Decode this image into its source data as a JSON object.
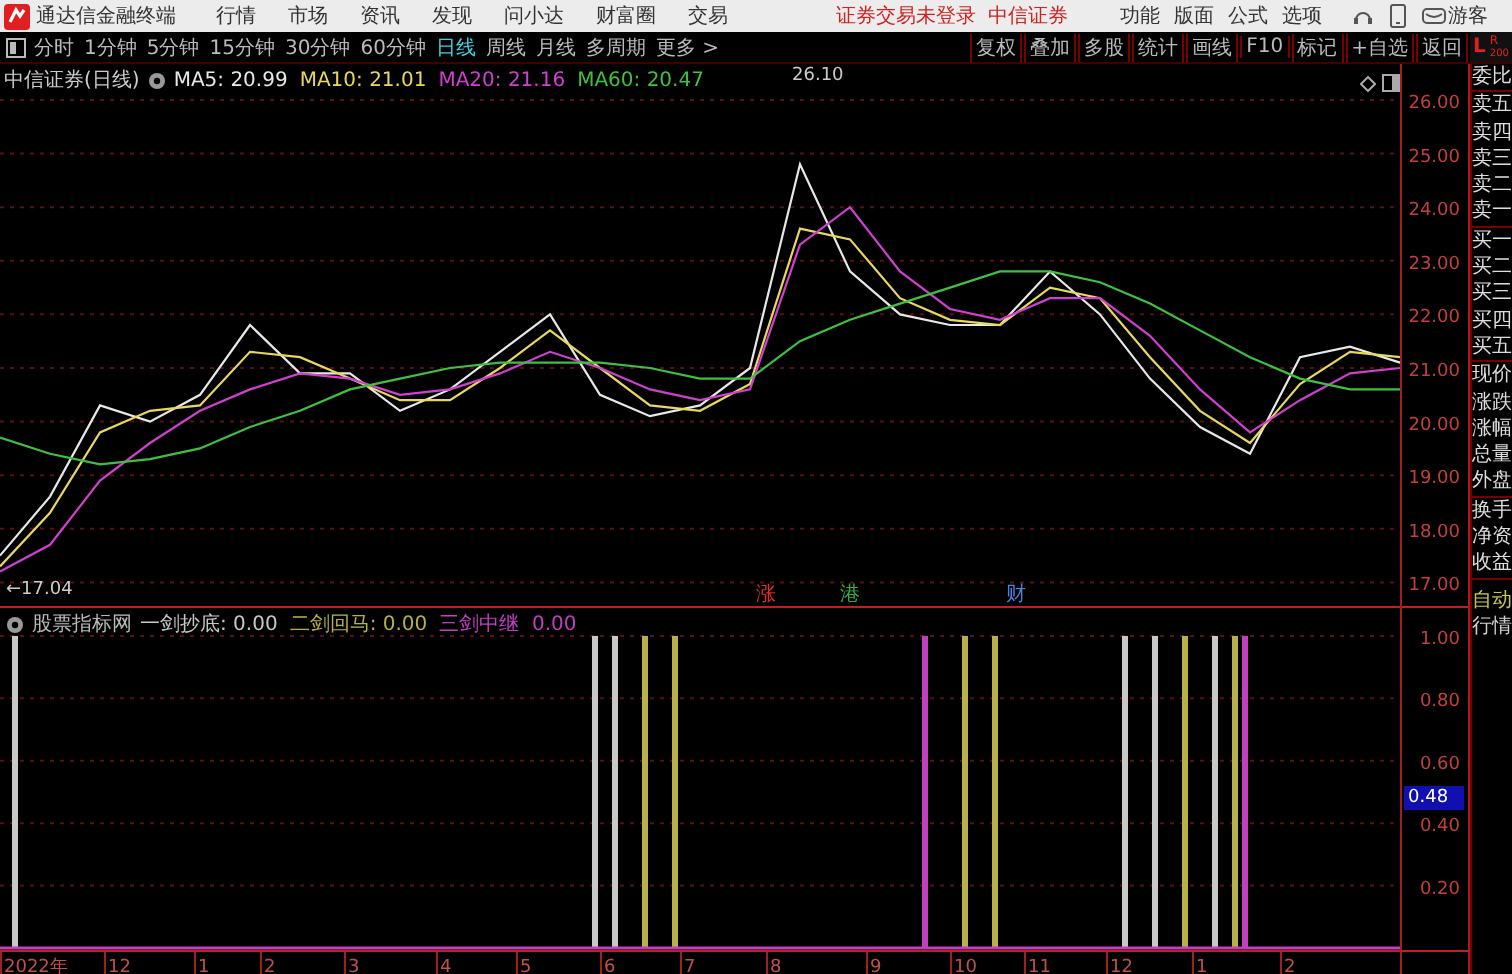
{
  "app_bar": {
    "app_name": "通达信金融终端",
    "menus": [
      "行情",
      "市场",
      "资讯",
      "发现",
      "问小达",
      "财富圈",
      "交易"
    ],
    "login_status": "证券交易未登录",
    "broker": "中信证券",
    "tools": [
      "功能",
      "版面",
      "公式",
      "选项"
    ],
    "user": "游客"
  },
  "period_bar": {
    "periods": [
      {
        "label": "分时",
        "selected": false
      },
      {
        "label": "1分钟",
        "selected": false
      },
      {
        "label": "5分钟",
        "selected": false
      },
      {
        "label": "15分钟",
        "selected": false
      },
      {
        "label": "30分钟",
        "selected": false
      },
      {
        "label": "60分钟",
        "selected": false
      },
      {
        "label": "日线",
        "selected": true
      },
      {
        "label": "周线",
        "selected": false
      },
      {
        "label": "月线",
        "selected": false
      },
      {
        "label": "多周期",
        "selected": false
      },
      {
        "label": "更多 >",
        "selected": false
      }
    ],
    "actions": [
      "复权",
      "叠加",
      "多股",
      "统计",
      "画线",
      "F10",
      "标记",
      "+自选",
      "返回"
    ]
  },
  "quote_badge": {
    "left": "L",
    "right": "R",
    "sub": "200"
  },
  "main_chart": {
    "title": "中信证券(日线)",
    "legend": [
      ": 20.99",
      ": 21.01",
      ": 21.16",
      ": 20.47"
    ],
    "event_tags": [
      {
        "label": "涨",
        "color": "#d83030"
      },
      {
        "label": "港",
        "color": "#30b040"
      },
      {
        "label": "财",
        "color": "#5080e0"
      }
    ],
    "chart_data": {
      "type": "line",
      "grid": true,
      "categories": [
        null,
        null,
        null,
        null,
        null,
        null,
        null,
        null,
        null,
        null,
        null,
        null,
        null,
        null,
        null,
        null,
        null,
        null,
        null,
        null,
        null,
        null,
        null,
        null,
        null,
        null,
        null,
        null,
        null
      ],
      "ylim": [
        16.56,
        26.67
      ],
      "yticks": [
        {
          "value": 17,
          "label": "17.00"
        },
        {
          "value": 18,
          "label": "18.00"
        },
        {
          "value": 19,
          "label": "19.00"
        },
        {
          "value": 20,
          "label": "20.00"
        },
        {
          "value": 21,
          "label": "21.00"
        },
        {
          "value": 22,
          "label": "22.00"
        },
        {
          "value": 23,
          "label": "23.00"
        },
        {
          "value": 24,
          "label": "24.00"
        },
        {
          "value": 25,
          "label": "25.00"
        },
        {
          "value": 26,
          "label": "26.00"
        }
      ],
      "series": [
        {
          "name": "MA5",
          "color": "#e8e8e8",
          "values": [
            17.5,
            18.6,
            20.3,
            20.0,
            20.5,
            21.8,
            20.9,
            20.9,
            20.2,
            20.6,
            21.3,
            22.0,
            20.5,
            20.1,
            20.3,
            21.0,
            24.8,
            22.8,
            22.0,
            21.8,
            21.8,
            22.8,
            22.0,
            20.8,
            19.9,
            19.4,
            21.2,
            21.4,
            21.1
          ]
        },
        {
          "name": "MA10",
          "color": "#e8d860",
          "values": [
            17.3,
            18.3,
            19.8,
            20.2,
            20.3,
            21.3,
            21.2,
            20.8,
            20.4,
            20.4,
            21.0,
            21.7,
            21.0,
            20.3,
            20.2,
            20.7,
            23.6,
            23.4,
            22.3,
            21.9,
            21.8,
            22.5,
            22.3,
            21.2,
            20.2,
            19.6,
            20.7,
            21.3,
            21.2
          ]
        },
        {
          "name": "MA20",
          "color": "#d040d0",
          "values": [
            17.2,
            17.7,
            18.9,
            19.6,
            20.2,
            20.6,
            20.9,
            20.8,
            20.5,
            20.6,
            20.9,
            21.3,
            21.0,
            20.6,
            20.4,
            20.6,
            23.3,
            24.0,
            22.8,
            22.1,
            21.9,
            22.3,
            22.3,
            21.6,
            20.6,
            19.8,
            20.4,
            20.9,
            21.0
          ]
        },
        {
          "name": "MA60",
          "color": "#40c040",
          "values": [
            19.7,
            19.4,
            19.2,
            19.3,
            19.5,
            19.9,
            20.2,
            20.6,
            20.8,
            21.0,
            21.1,
            21.1,
            21.1,
            21.0,
            20.8,
            20.8,
            21.5,
            21.9,
            22.2,
            22.5,
            22.8,
            22.8,
            22.6,
            22.2,
            21.7,
            21.2,
            20.8,
            20.6,
            20.6
          ]
        }
      ],
      "annotations": [
        "26.10",
        "←17.04"
      ]
    }
  },
  "indicator": {
    "title": "股票指标网",
    "legend": [
      ": 0.00",
      ": 0.00",
      "  0.00"
    ],
    "cursor_value": "0.48",
    "date_axis": [
      "2022年",
      "12",
      "1",
      "2",
      "3",
      "4",
      "5",
      "6",
      "7",
      "8",
      "9",
      "10",
      "11",
      "12",
      "1",
      "2"
    ],
    "chart_data": {
      "type": "bar",
      "grid": true,
      "stacked": true,
      "categories": [
        null,
        null,
        null,
        null,
        null,
        null,
        null,
        null,
        null,
        null,
        null,
        null,
        null,
        null,
        null,
        null,
        null,
        null,
        null,
        null,
        null,
        null,
        null,
        null,
        null,
        null,
        null,
        null,
        null,
        null,
        null,
        null,
        null,
        null,
        null,
        null,
        null,
        null,
        null,
        null,
        null,
        null,
        null,
        null,
        null,
        null,
        null,
        null,
        null,
        null,
        null,
        null,
        null,
        null,
        null,
        null,
        null,
        null,
        null,
        null,
        null,
        null,
        null,
        null,
        null,
        null,
        null,
        null,
        null,
        null,
        null,
        null,
        null,
        null,
        null,
        null,
        null,
        null,
        null,
        null,
        null,
        null,
        null,
        null,
        null,
        null,
        null,
        null,
        null,
        null,
        null,
        null,
        null,
        null,
        null,
        null,
        null,
        null,
        null,
        null,
        null,
        null,
        null,
        null,
        null,
        null,
        null,
        null,
        null,
        null,
        null,
        null,
        null,
        null,
        null,
        null,
        null,
        null,
        null,
        null,
        null,
        null,
        null,
        null,
        null,
        null,
        null,
        null,
        null,
        null,
        null,
        null,
        null,
        null,
        null,
        null,
        null,
        null,
        null,
        null
      ],
      "ylim": [
        0,
        1.096
      ],
      "yticks": [
        {
          "value": 0.2,
          "label": "0.20"
        },
        {
          "value": 0.4,
          "label": "0.40"
        },
        {
          "value": 0.6,
          "label": "0.60"
        },
        {
          "value": 0.8,
          "label": "0.80"
        },
        {
          "value": 1,
          "label": "1.00"
        }
      ],
      "series": [
        {
          "name": "一剑抄底",
          "color": "#c8c8c8",
          "values": [
            null,
            1,
            null,
            null,
            null,
            null,
            null,
            null,
            null,
            null,
            null,
            null,
            null,
            null,
            null,
            null,
            null,
            null,
            null,
            null,
            null,
            null,
            null,
            null,
            null,
            null,
            null,
            null,
            null,
            null,
            null,
            null,
            null,
            null,
            null,
            null,
            null,
            null,
            null,
            null,
            null,
            null,
            null,
            null,
            null,
            null,
            null,
            null,
            null,
            null,
            null,
            null,
            null,
            null,
            null,
            null,
            null,
            null,
            null,
            1,
            null,
            1,
            null,
            null,
            null,
            null,
            null,
            null,
            null,
            null,
            null,
            null,
            null,
            null,
            null,
            null,
            null,
            null,
            null,
            null,
            null,
            null,
            null,
            null,
            null,
            null,
            null,
            null,
            null,
            null,
            null,
            null,
            null,
            null,
            null,
            null,
            null,
            null,
            null,
            null,
            null,
            null,
            null,
            null,
            null,
            null,
            null,
            null,
            null,
            null,
            null,
            null,
            1,
            null,
            null,
            1,
            null,
            null,
            null,
            null,
            null,
            1,
            null,
            null,
            null,
            null,
            null,
            null,
            null,
            null,
            null,
            null,
            null,
            null,
            null,
            null,
            null,
            null,
            null,
            null
          ]
        },
        {
          "name": "二剑回马",
          "color": "#b8b048",
          "values": [
            null,
            null,
            null,
            null,
            null,
            null,
            null,
            null,
            null,
            null,
            null,
            null,
            null,
            null,
            null,
            null,
            null,
            null,
            null,
            null,
            null,
            null,
            null,
            null,
            null,
            null,
            null,
            null,
            null,
            null,
            null,
            null,
            null,
            null,
            null,
            null,
            null,
            null,
            null,
            null,
            null,
            null,
            null,
            null,
            null,
            null,
            null,
            null,
            null,
            null,
            null,
            null,
            null,
            null,
            null,
            null,
            null,
            null,
            null,
            null,
            null,
            null,
            null,
            null,
            1,
            null,
            null,
            1,
            null,
            null,
            null,
            null,
            null,
            null,
            null,
            null,
            null,
            null,
            null,
            null,
            null,
            null,
            null,
            null,
            null,
            null,
            null,
            null,
            null,
            null,
            null,
            null,
            null,
            null,
            null,
            null,
            1,
            null,
            null,
            1,
            null,
            null,
            null,
            null,
            null,
            null,
            null,
            null,
            null,
            null,
            null,
            null,
            null,
            null,
            null,
            null,
            null,
            null,
            1,
            null,
            null,
            null,
            null,
            1,
            null,
            null,
            null,
            null,
            null,
            null,
            null,
            null,
            null,
            null,
            null,
            null,
            null,
            null,
            null,
            null
          ]
        },
        {
          "name": "三剑中继",
          "color": "#c040c0",
          "values": [
            null,
            null,
            null,
            null,
            null,
            null,
            null,
            null,
            null,
            null,
            null,
            null,
            null,
            null,
            null,
            null,
            null,
            null,
            null,
            null,
            null,
            null,
            null,
            null,
            null,
            null,
            null,
            null,
            null,
            null,
            null,
            null,
            null,
            null,
            null,
            null,
            null,
            null,
            null,
            null,
            null,
            null,
            null,
            null,
            null,
            null,
            null,
            null,
            null,
            null,
            null,
            null,
            null,
            null,
            null,
            null,
            null,
            null,
            null,
            null,
            null,
            null,
            null,
            null,
            null,
            null,
            null,
            null,
            null,
            null,
            null,
            null,
            null,
            null,
            null,
            null,
            null,
            null,
            null,
            null,
            null,
            null,
            null,
            null,
            null,
            null,
            null,
            null,
            null,
            null,
            null,
            null,
            1,
            null,
            null,
            null,
            null,
            null,
            null,
            null,
            null,
            null,
            null,
            null,
            null,
            null,
            null,
            null,
            null,
            null,
            null,
            null,
            null,
            null,
            null,
            null,
            null,
            null,
            null,
            null,
            null,
            null,
            null,
            null,
            1,
            null,
            null,
            null,
            null,
            null,
            null,
            null,
            null,
            null,
            null,
            null,
            null,
            null,
            null,
            null
          ]
        }
      ]
    }
  },
  "quote_panel": {
    "groups": [
      [
        "委比"
      ],
      [
        "卖五",
        "卖四",
        "卖三",
        "卖二",
        "卖一"
      ],
      [
        "买一",
        "买二",
        "买三",
        "买四",
        "买五"
      ],
      [
        "现价",
        "涨跌",
        "涨幅",
        "总量",
        "外盘"
      ],
      [
        "换手",
        "净资",
        "收益"
      ]
    ],
    "modes": [
      {
        "label": "自动",
        "color": "#c8c850"
      },
      {
        "label": "行情",
        "color": "#d0d0d0"
      }
    ]
  }
}
